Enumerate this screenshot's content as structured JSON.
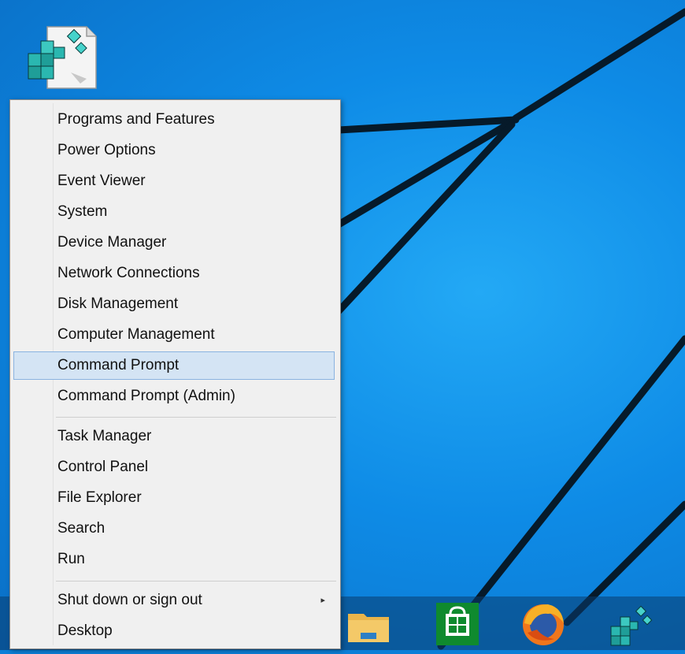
{
  "menu": {
    "items": [
      {
        "label": "Programs and Features"
      },
      {
        "label": "Power Options"
      },
      {
        "label": "Event Viewer"
      },
      {
        "label": "System"
      },
      {
        "label": "Device Manager"
      },
      {
        "label": "Network Connections"
      },
      {
        "label": "Disk Management"
      },
      {
        "label": "Computer Management"
      },
      {
        "label": "Command Prompt",
        "selected": true
      },
      {
        "label": "Command Prompt (Admin)"
      },
      {
        "label": "Task Manager"
      },
      {
        "label": "Control Panel"
      },
      {
        "label": "File Explorer"
      },
      {
        "label": "Search"
      },
      {
        "label": "Run"
      },
      {
        "label": "Shut down or sign out",
        "has_submenu": true
      },
      {
        "label": "Desktop"
      }
    ],
    "submenu_arrow": "▸"
  },
  "desktop": {
    "icons": [
      {
        "name": "registry-file-icon"
      }
    ]
  },
  "taskbar": {
    "pinned": [
      {
        "name": "file-explorer-icon"
      },
      {
        "name": "store-icon"
      },
      {
        "name": "firefox-icon"
      },
      {
        "name": "registry-editor-icon"
      }
    ]
  },
  "colors": {
    "wallpaper": "#0e8be6",
    "menu_bg": "#f0f0f0",
    "selection_bg": "#d4e4f4",
    "selection_border": "#8ab3e0",
    "store_green": "#0f8a2e",
    "firefox_orange": "#f0761c"
  }
}
